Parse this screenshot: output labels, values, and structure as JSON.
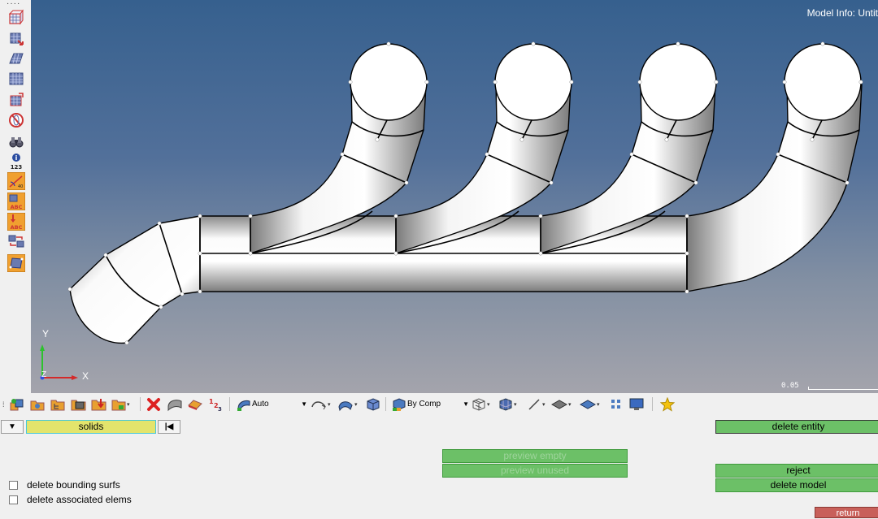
{
  "viewport": {
    "model_info": "Model Info: Untit",
    "axis": {
      "y": "Y",
      "x": "X",
      "z": "Z"
    },
    "scale_label": "0.05"
  },
  "left_toolbar": {
    "icons": [
      "mesh-cube-icon",
      "mesh-arrow-icon",
      "mesh-plane-icon",
      "mesh-grid-icon",
      "mesh-edit-icon",
      "sphere-no-icon",
      "binoculars-icon",
      "info-123-icon",
      "measure-icon",
      "label-abc-icon",
      "arrow-abc-icon",
      "exchange-icon",
      "surface-frame-icon"
    ]
  },
  "toolbar": {
    "vis_mode": "Auto",
    "color_mode": "By Comp"
  },
  "panel": {
    "entity_selector": "solids",
    "delete_entity": "delete entity",
    "preview_empty": "preview empty",
    "preview_unused": "preview unused",
    "reject": "reject",
    "delete_model": "delete model",
    "return": "return",
    "checkbox_1": "delete bounding surfs",
    "checkbox_2": "delete associated elems"
  },
  "colors": {
    "button_green": "#6cc067",
    "return_red": "#c8605a",
    "selector_yellow": "#e3e46c"
  }
}
